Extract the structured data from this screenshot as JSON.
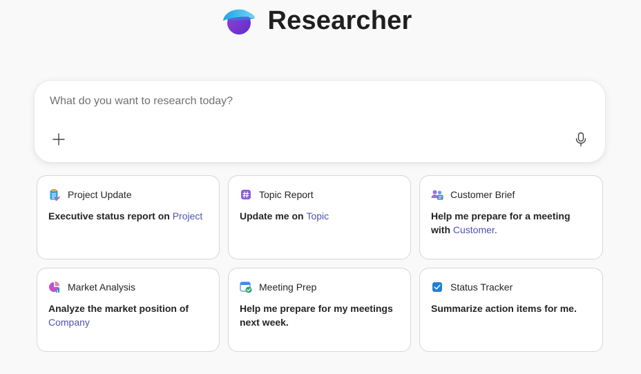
{
  "header": {
    "title": "Researcher",
    "logo_icon": "researcher-logo-icon"
  },
  "search": {
    "placeholder": "What do you want to research today?",
    "value": "",
    "add_icon": "plus-icon",
    "mic_icon": "microphone-icon"
  },
  "cards": [
    {
      "title": "Project Update",
      "icon": "clipboard-icon",
      "prompt": "Executive status report on ",
      "link": "Project",
      "suffix": ""
    },
    {
      "title": "Topic Report",
      "icon": "hashtag-icon",
      "prompt": "Update me on ",
      "link": "Topic",
      "suffix": ""
    },
    {
      "title": "Customer Brief",
      "icon": "people-icon",
      "prompt": "Help me prepare for a meeting with ",
      "link": "Customer",
      "suffix": "."
    },
    {
      "title": "Market Analysis",
      "icon": "pie-chart-icon",
      "prompt": "Analyze the market position of ",
      "link": "Company",
      "suffix": ""
    },
    {
      "title": "Meeting Prep",
      "icon": "calendar-check-icon",
      "prompt": "Help me prepare for my meetings next week.",
      "link": "",
      "suffix": ""
    },
    {
      "title": "Status Tracker",
      "icon": "checkbox-icon",
      "prompt": "Summarize action items for me.",
      "link": "",
      "suffix": ""
    }
  ],
  "colors": {
    "background": "#f9f9f9",
    "link": "#4f52b2",
    "card_border": "#d6d6d6",
    "text": "#242424"
  }
}
